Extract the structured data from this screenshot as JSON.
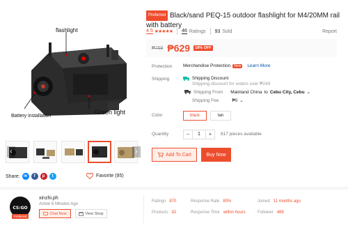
{
  "product": {
    "main_image_alt": "",
    "callouts": {
      "flashlight": "flashlight",
      "battery": "Battery installation",
      "green_light": "Green light"
    },
    "thumbnails": [
      {
        "name": "thumb-1"
      },
      {
        "name": "thumb-2"
      },
      {
        "name": "thumb-3"
      },
      {
        "name": "thumb-4"
      },
      {
        "name": "thumb-5"
      }
    ],
    "share_label": "Share:",
    "favorite_label": "Favorite (95)",
    "badge": "Preferred",
    "title": "Black/sand PEQ-15 outdoor flashlight for M4/20MM rail with battery",
    "rating_value": "4.5",
    "stars": "★★★★★",
    "ratings_count": "46",
    "ratings_label": "Ratings",
    "sold_count": "93",
    "sold_label": "Sold",
    "report_label": "Report",
    "old_price": "₱769",
    "price": "₱629",
    "discount": "18% OFF"
  },
  "details": {
    "protection_label": "Protection",
    "protection_value": "Merchandise Protection",
    "new_tag": "New",
    "learn_more": "Learn More",
    "shipping_label": "Shipping",
    "shipping_discount": "Shipping Discount",
    "shipping_discount_sub": "Shipping discount for orders over ₱249",
    "shipping_from_label": "Shipping From",
    "shipping_from_value": "Mainland China",
    "shipping_to": "to",
    "shipping_city": "Cebu City, Cebu",
    "shipping_fee_label": "Shipping Fee",
    "shipping_fee_value": "₱0",
    "color_label": "Color",
    "colors": [
      "black",
      "tan"
    ],
    "selected_color": "black",
    "quantity_label": "Quantity",
    "quantity": "1",
    "available": "817 pieces available",
    "add_to_cart": "Add To Cart",
    "buy_now": "Buy Now"
  },
  "shop": {
    "name": "xinzhi.ph",
    "active": "Active 6 Minutes Ago",
    "badge": "Preferred",
    "chat": "Chat Now",
    "view": "View Shop",
    "stats": {
      "ratings_label": "Ratings",
      "ratings": "870",
      "products_label": "Products",
      "products": "82",
      "response_rate_label": "Response Rate",
      "response_rate": "80%",
      "response_time_label": "Response Time",
      "response_time": "within hours",
      "joined_label": "Joined",
      "joined": "11 months ago",
      "follower_label": "Follower",
      "follower": "489"
    }
  },
  "colors": {
    "accent": "#ee4d2d",
    "link": "#0055aa"
  }
}
